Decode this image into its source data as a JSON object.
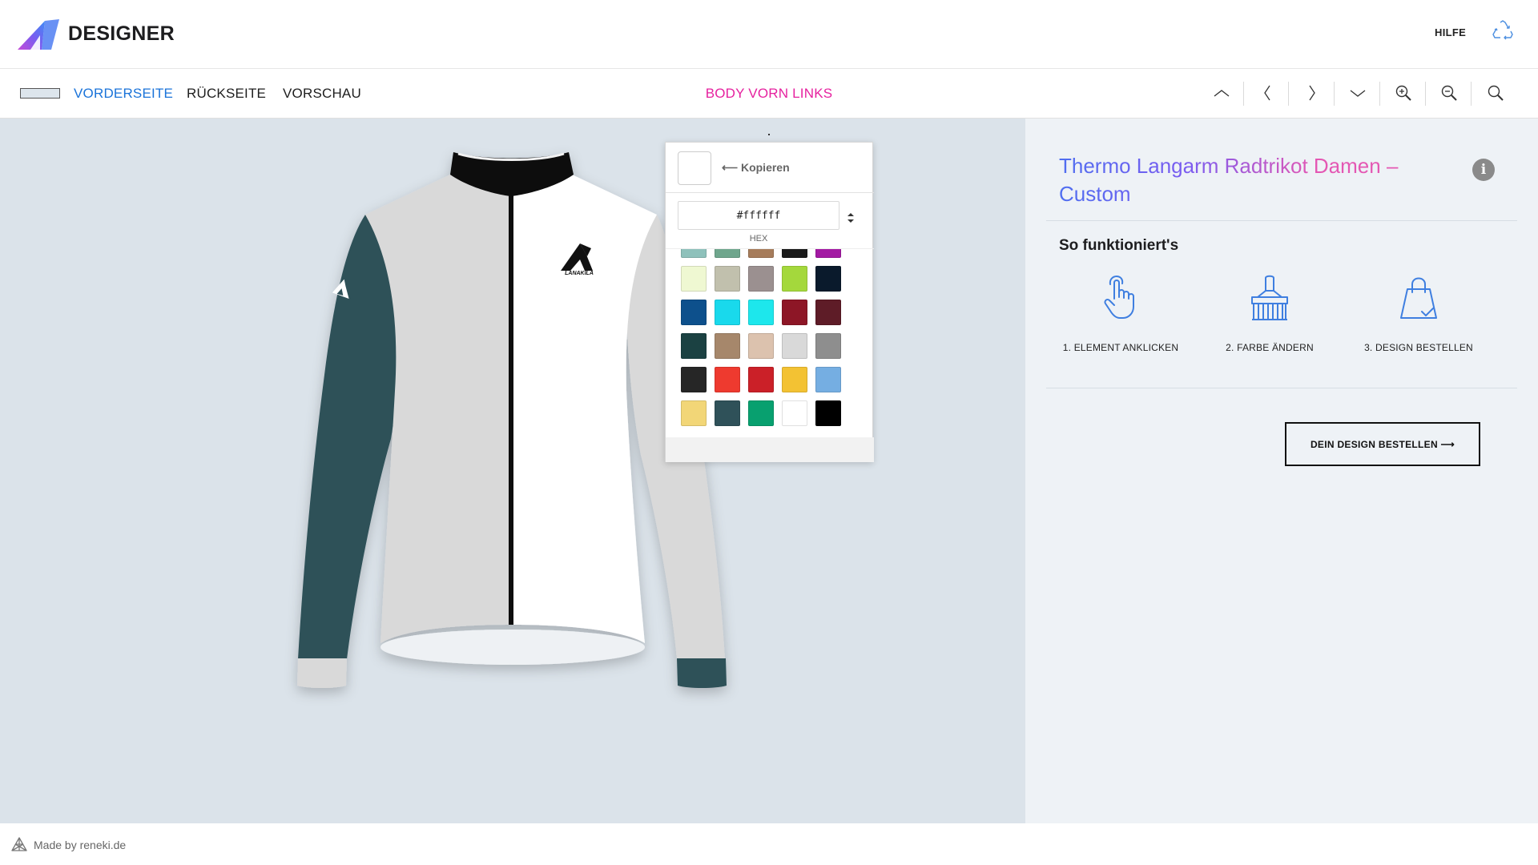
{
  "header": {
    "brand": "DESIGNER",
    "help_label": "HILFE",
    "icons": [
      "designer-logo-icon",
      "recycle-icon"
    ]
  },
  "toolbar": {
    "color_chip": "#dde5ec",
    "tabs": [
      {
        "label": "VORDERSEITE",
        "active": true
      },
      {
        "label": "RÜCKSEITE",
        "active": false
      },
      {
        "label": "VORSCHAU",
        "active": false
      }
    ],
    "area_title": "BODY VORN LINKS",
    "tools": [
      "chevron-up-icon",
      "chevron-left-icon",
      "chevron-right-icon",
      "chevron-down-icon",
      "zoom-in-icon",
      "zoom-out-icon",
      "search-icon"
    ]
  },
  "canvas": {
    "logo_text": "LANAKILA",
    "colors": {
      "sleeves": "#2f5159",
      "body_left": "#d9d9d9",
      "body_right": "#ffffff",
      "collar": "#0a0a0a",
      "zipper": "#0a0a0a",
      "cuff_left": "#d9d9d9",
      "cuff_right": "#2f5159"
    }
  },
  "picker": {
    "current_color": "#ffffff",
    "copy_label": "⟵ Kopieren",
    "hex_value": "#ffffff",
    "hex_label": "HEX",
    "swatches": [
      [
        "#8ec1bb",
        "#6fa68d",
        "#a67c5b",
        "#1a1a1a",
        "#a31aa3"
      ],
      [
        "#eff8d2",
        "#c1c0ad",
        "#9b9090",
        "#a4d83c",
        "#0a1a2c"
      ],
      [
        "#0d508c",
        "#19d9ec",
        "#1de7ec",
        "#8d1626",
        "#5e1c27"
      ],
      [
        "#1b4142",
        "#a6876b",
        "#dcc2ae",
        "#d9d9d9",
        "#8e8e8e"
      ],
      [
        "#262626",
        "#ee3a2f",
        "#cb2028",
        "#f3c233",
        "#75aee2"
      ],
      [
        "#f2d677",
        "#2f5159",
        "#08a06f",
        "#ffffff",
        "#000000"
      ]
    ]
  },
  "panel": {
    "product_title": "Thermo Langarm Radtrikot Damen – Custom",
    "how_title": "So funktioniert's",
    "steps": [
      {
        "label": "1. ELEMENT ANKLICKEN",
        "icon": "hand-pointer-icon"
      },
      {
        "label": "2. FARBE ÄNDERN",
        "icon": "paint-brush-icon"
      },
      {
        "label": "3. DESIGN BESTELLEN",
        "icon": "shopping-bag-icon"
      }
    ],
    "order_button": "DEIN DESIGN BESTELLEN ⟶"
  },
  "footer": {
    "text": "Made by reneki.de"
  }
}
